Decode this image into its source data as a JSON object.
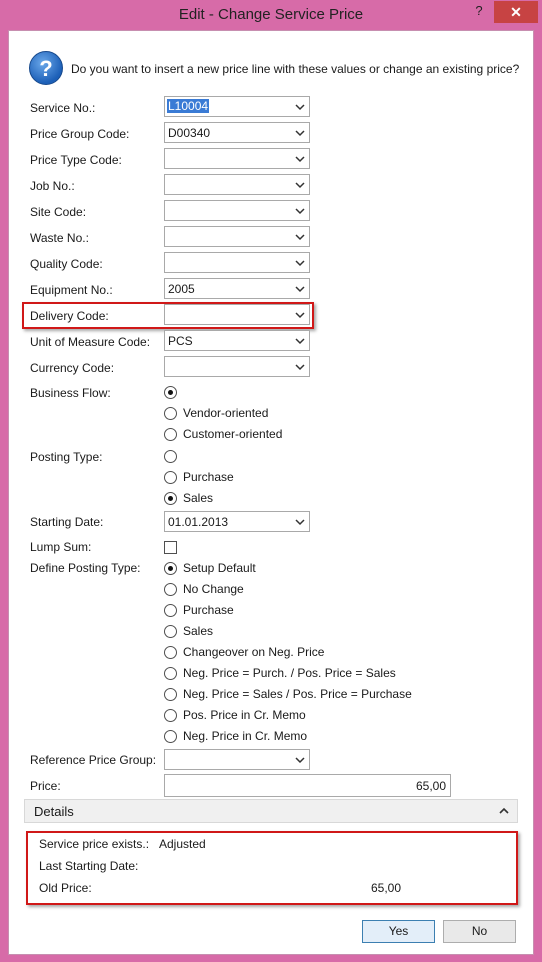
{
  "window": {
    "title": "Edit - Change Service Price",
    "help_label": "?",
    "close_label": "✕"
  },
  "question": "Do you want to insert a new price line with these values or change an existing price?",
  "fields": {
    "service_no": {
      "label": "Service No.:",
      "value": "L10004"
    },
    "price_group_code": {
      "label": "Price Group Code:",
      "value": "D00340"
    },
    "price_type_code": {
      "label": "Price Type Code:",
      "value": ""
    },
    "job_no": {
      "label": "Job No.:",
      "value": ""
    },
    "site_code": {
      "label": "Site Code:",
      "value": ""
    },
    "waste_no": {
      "label": "Waste No.:",
      "value": ""
    },
    "quality_code": {
      "label": "Quality Code:",
      "value": ""
    },
    "equipment_no": {
      "label": "Equipment No.:",
      "value": "2005"
    },
    "delivery_code": {
      "label": "Delivery Code:",
      "value": ""
    },
    "unit_of_measure_code": {
      "label": "Unit of Measure Code:",
      "value": "PCS"
    },
    "currency_code": {
      "label": "Currency Code:",
      "value": ""
    },
    "starting_date": {
      "label": "Starting Date:",
      "value": "01.01.2013"
    },
    "lump_sum": {
      "label": "Lump Sum:",
      "checked": false
    },
    "reference_price_group": {
      "label": "Reference Price Group:",
      "value": ""
    },
    "price": {
      "label": "Price:",
      "value": "65,00"
    }
  },
  "business_flow": {
    "label": "Business Flow:",
    "options": [
      "",
      "Vendor-oriented",
      "Customer-oriented"
    ],
    "selected": 0
  },
  "posting_type": {
    "label": "Posting Type:",
    "options": [
      "",
      "Purchase",
      "Sales"
    ],
    "selected": 2
  },
  "define_posting_type": {
    "label": "Define Posting Type:",
    "options": [
      "Setup Default",
      "No Change",
      "Purchase",
      "Sales",
      "Changeover on Neg. Price",
      "Neg. Price = Purch. / Pos. Price = Sales",
      "Neg. Price = Sales / Pos. Price = Purchase",
      "Pos. Price in Cr. Memo",
      "Neg. Price in Cr. Memo"
    ],
    "selected": 0
  },
  "details": {
    "title": "Details",
    "service_price_exists_label": "Service price exists.:",
    "service_price_exists_value": "Adjusted",
    "last_starting_date_label": "Last Starting Date:",
    "last_starting_date_value": "",
    "old_price_label": "Old Price:",
    "old_price_value": "65,00"
  },
  "buttons": {
    "yes": "Yes",
    "no": "No"
  },
  "colors": {
    "window_frame": "#d76ba8",
    "close_button": "#c74343",
    "highlight_box": "#d01818",
    "selection": "#3a7bd5"
  }
}
